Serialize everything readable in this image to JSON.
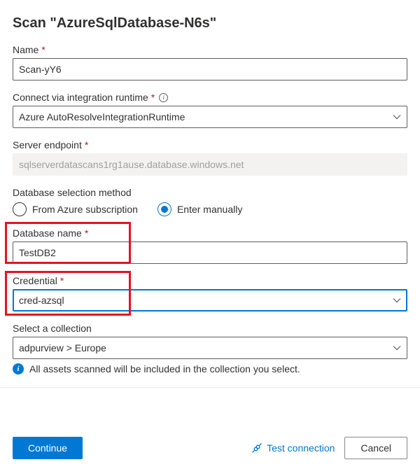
{
  "title": "Scan \"AzureSqlDatabase-N6s\"",
  "fields": {
    "name": {
      "label": "Name",
      "value": "Scan-yY6"
    },
    "runtime": {
      "label": "Connect via integration runtime",
      "value": "Azure AutoResolveIntegrationRuntime"
    },
    "endpoint": {
      "label": "Server endpoint",
      "value": "sqlserverdatascans1rg1ause.database.windows.net"
    },
    "selection": {
      "label": "Database selection method",
      "options": {
        "subscription": "From Azure subscription",
        "manual": "Enter manually"
      },
      "selected": "manual"
    },
    "dbname": {
      "label": "Database name",
      "value": "TestDB2"
    },
    "credential": {
      "label": "Credential",
      "value": "cred-azsql"
    },
    "collection": {
      "label": "Select a collection",
      "value": "adpurview > Europe"
    }
  },
  "info": "All assets scanned will be included in the collection you select.",
  "footer": {
    "continue": "Continue",
    "test": "Test connection",
    "cancel": "Cancel"
  }
}
